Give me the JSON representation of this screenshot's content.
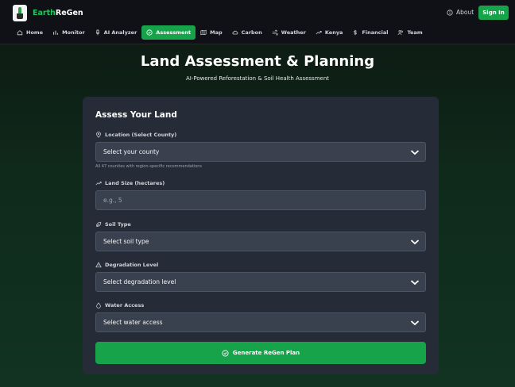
{
  "app": {
    "brand_part1": "Earth",
    "brand_part2": "ReGen",
    "logo_icon": "plant-pot-icon"
  },
  "header": {
    "about_label": "About",
    "signin_label": "Sign In"
  },
  "nav": {
    "items": [
      {
        "label": "Home",
        "icon": "home-icon"
      },
      {
        "label": "Monitor",
        "icon": "bar-chart-icon"
      },
      {
        "label": "AI Analyzer",
        "icon": "microphone-icon"
      },
      {
        "label": "Assessment",
        "icon": "check-circle-icon",
        "active": true
      },
      {
        "label": "Map",
        "icon": "map-icon"
      },
      {
        "label": "Carbon",
        "icon": "cloud-icon"
      },
      {
        "label": "Weather",
        "icon": "wind-icon"
      },
      {
        "label": "Kenya",
        "icon": "trending-icon"
      },
      {
        "label": "Financial",
        "icon": "dollar-icon"
      },
      {
        "label": "Team",
        "icon": "users-icon"
      }
    ]
  },
  "page": {
    "title": "Land Assessment & Planning",
    "subtitle": "AI-Powered Reforestation & Soil Health Assessment"
  },
  "form": {
    "title": "Assess Your Land",
    "location": {
      "label": "Location (Select County)",
      "selected": "Select your county",
      "hint": "All 47 counties with region-specific recommendations"
    },
    "land_size": {
      "label": "Land Size (hectares)",
      "placeholder": "e.g., 5"
    },
    "soil_type": {
      "label": "Soil Type",
      "selected": "Select soil type"
    },
    "degradation": {
      "label": "Degradation Level",
      "selected": "Select degradation level"
    },
    "water": {
      "label": "Water Access",
      "selected": "Select water access"
    },
    "submit_label": "Generate ReGen Plan"
  },
  "colors": {
    "accent": "#16a34a",
    "card": "#252b37",
    "input": "#3a414e"
  }
}
